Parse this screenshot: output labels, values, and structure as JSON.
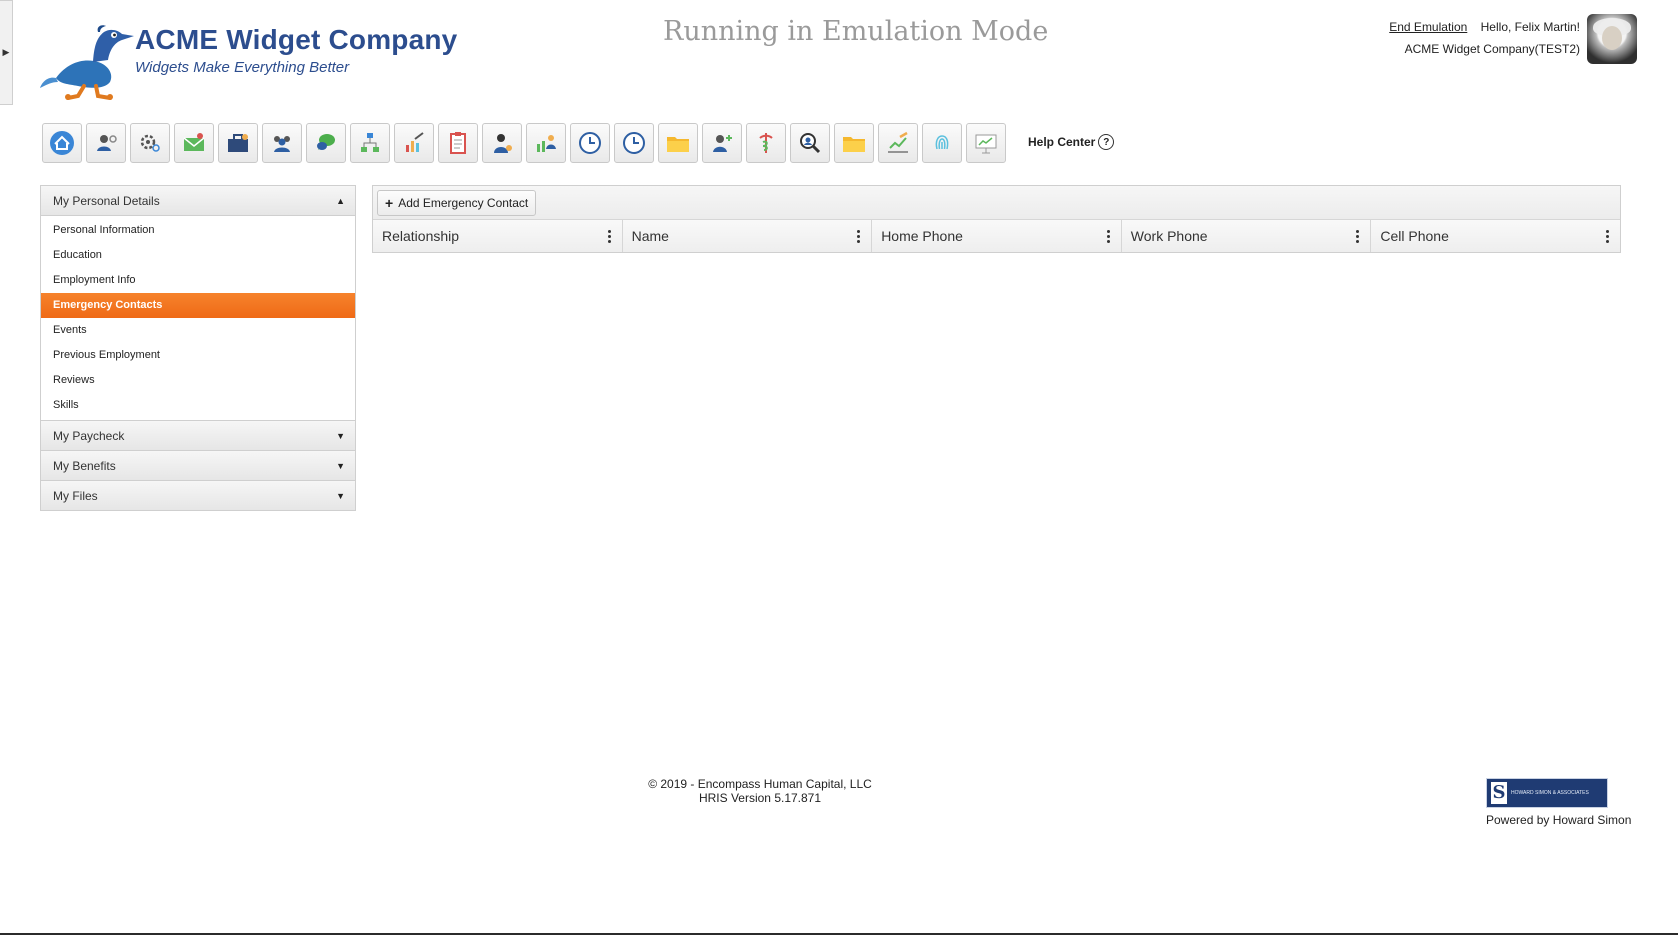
{
  "header": {
    "company_name": "ACME Widget Company",
    "tagline": "Widgets Make Everything Better",
    "emulation_title": "Running in Emulation Mode",
    "end_emulation": "End Emulation",
    "greeting": "Hello, Felix Martin!",
    "company_context": "ACME Widget Company(TEST2)"
  },
  "toolbar": {
    "icons": [
      "home-icon",
      "user-settings-icon",
      "gear-icon",
      "mail-icon",
      "briefcase-icon",
      "team-icon",
      "chat-icon",
      "org-chart-icon",
      "chart-edit-icon",
      "clipboard-icon",
      "employee-icon",
      "group-chart-icon",
      "clock-icon",
      "clock-icon",
      "folder-icon",
      "user-add-icon",
      "medical-icon",
      "search-user-icon",
      "folder-icon",
      "edit-chart-icon",
      "fingerprint-icon",
      "presentation-icon"
    ],
    "help_label": "Help Center",
    "help_symbol": "?"
  },
  "sidebar": {
    "sections": [
      {
        "label": "My Personal Details",
        "arrow": "▲"
      },
      {
        "label": "My Paycheck",
        "arrow": "▼"
      },
      {
        "label": "My Benefits",
        "arrow": "▼"
      },
      {
        "label": "My Files",
        "arrow": "▼"
      }
    ],
    "items": [
      "Personal Information",
      "Education",
      "Employment Info",
      "Emergency Contacts",
      "Events",
      "Previous Employment",
      "Reviews",
      "Skills"
    ],
    "active_item": "Emergency Contacts"
  },
  "grid": {
    "add_button": "Add Emergency Contact",
    "add_symbol": "+",
    "columns": [
      "Relationship",
      "Name",
      "Home Phone",
      "Work Phone",
      "Cell Phone"
    ]
  },
  "footer": {
    "copyright": "© 2019 - Encompass Human Capital, LLC",
    "version": "HRIS Version 5.17.871",
    "powered_by": "Powered by Howard Simon",
    "logo_text": "HOWARD SIMON & ASSOCIATES"
  },
  "colors": {
    "brand": "#2c4d8e",
    "active": "#f07222"
  }
}
